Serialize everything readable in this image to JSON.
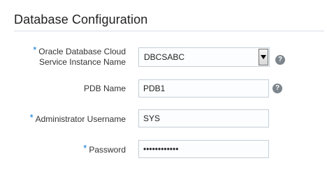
{
  "section": {
    "title": "Database Configuration"
  },
  "fields": {
    "instance": {
      "required_marker": "*",
      "label_line1": "Oracle Database Cloud",
      "label_line2": "Service Instance Name",
      "value": "DBCSABC"
    },
    "pdb": {
      "label": "PDB Name",
      "value": "PDB1"
    },
    "admin_username": {
      "required_marker": "*",
      "label": "Administrator Username",
      "value": "SYS"
    },
    "password": {
      "required_marker": "*",
      "label": "Password",
      "value": "············"
    }
  },
  "icons": {
    "help_glyph": "?",
    "help_icon": "question-circle-icon",
    "dropdown_icon": "chevron-down-icon"
  },
  "colors": {
    "required": "#0572ce",
    "help_icon_bg": "#7d868c",
    "field_border": "#c4ced7"
  }
}
